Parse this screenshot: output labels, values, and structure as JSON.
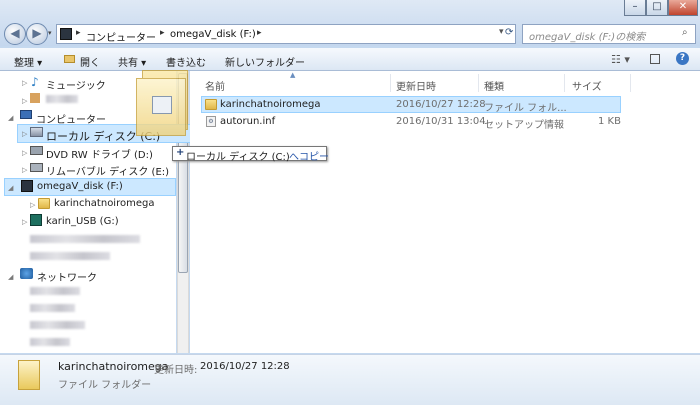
{
  "address": {
    "crumbs": [
      "コンピューター",
      "omegaV_disk (F:)"
    ]
  },
  "search": {
    "placeholder": "omegaV_disk (F:)の検索"
  },
  "toolbar": {
    "organize": "整理 ▾",
    "open": "開く",
    "share": "共有 ▾",
    "burn": "書き込む",
    "new_folder": "新しいフォルダー"
  },
  "nav": {
    "music": "ミュージック",
    "computer": "コンピューター",
    "local_disk": "ローカル ディスク (C:)",
    "dvd": "DVD RW ドライブ (D:)",
    "removable": "リムーバブル ディスク (E:)",
    "omega": "omegaV_disk (F:)",
    "karin_folder": "karinchatnoiromega",
    "karin_usb": "karin_USB (G:)",
    "network": "ネットワーク"
  },
  "drag_tooltip": {
    "plus": "+",
    "text": "ローカル ディスク (C:)",
    "suffix": "へコピー"
  },
  "columns": {
    "name": "名前",
    "date": "更新日時",
    "type": "種類",
    "size": "サイズ"
  },
  "files": [
    {
      "name": "karinchatnoiromega",
      "date": "2016/10/27 12:28",
      "type": "ファイル フォル...",
      "size": ""
    },
    {
      "name": "autorun.inf",
      "date": "2016/10/31 13:04",
      "type": "セットアップ情報",
      "size": "1 KB"
    }
  ],
  "details": {
    "name": "karinchatnoiromega",
    "date_label": "更新日時:",
    "date": "2016/10/27 12:28",
    "type": "ファイル フォルダー"
  },
  "colors": {
    "selection": "#cce8ff",
    "selection_border": "#99d1ff",
    "chrome": "#c5d9ef"
  }
}
